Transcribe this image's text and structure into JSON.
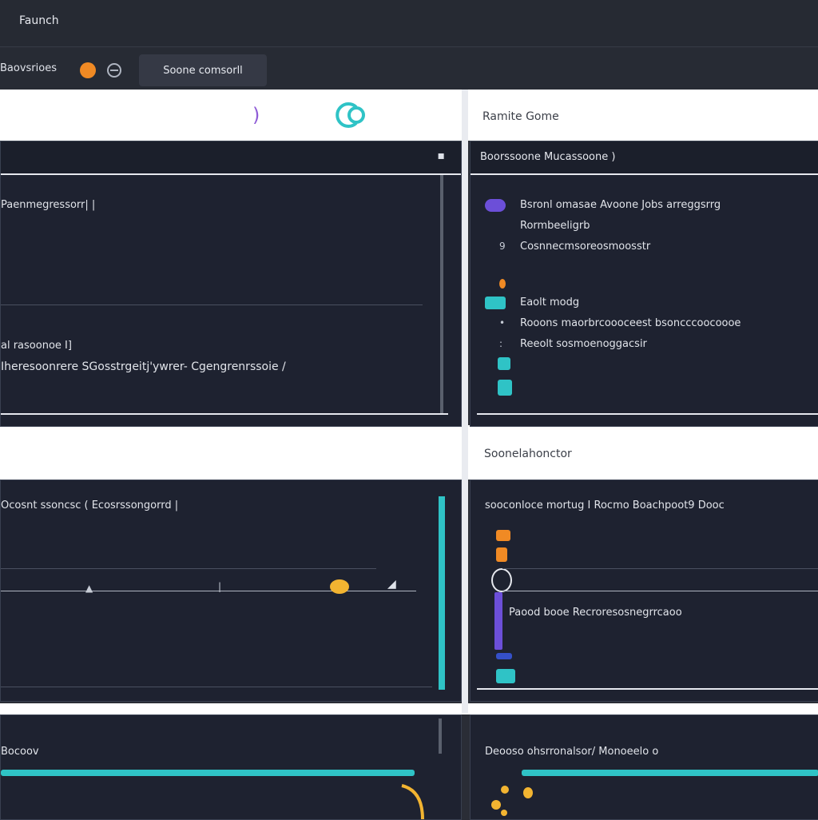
{
  "window": {
    "title": "Faunch"
  },
  "toolbar": {
    "nav_label": "Baovsrioes",
    "button_label": "Soone comsorll"
  },
  "bands": {
    "top_right_label": "Ramite Gome",
    "mid_right_label": "Soonelahonctor"
  },
  "panels": {
    "top_left": {
      "head": "",
      "row1": "Paenmegressorr| |",
      "row2": "al rasoonoe I]",
      "row3": "Iheresoonrere SGosstrgeitj'ywrer- Cgengrenrssoie /"
    },
    "top_right": {
      "head": "Boorssoone Mucassoone )",
      "items": [
        "Bsronl omasae Avoone Jobs arreggsrrg",
        "Rormbeeligrb",
        "Cosnnecmsoreosmoosstr",
        "Eaolt modg",
        "Rooons maorbrcoooceest bsoncccoocoooe",
        "Reeolt sosmoenoggacsir"
      ]
    },
    "mid_left": {
      "head": "Ocosnt ssoncsc ( Ecosrssongorrd |"
    },
    "mid_right": {
      "head": "sooconloce mortug I Rocmo Boachpoot9 Dooc",
      "row": "Paood booe Recroresosnegrrcaoo"
    },
    "bottom_left": {
      "head": "Bocoov"
    },
    "bottom_right": {
      "head": "Deooso ohsrronalsor/ Monoeelo o"
    }
  },
  "colors": {
    "accent_teal": "#2fc3c6",
    "accent_orange": "#f08a24",
    "accent_purple": "#6c4fd8",
    "panel_bg": "#1e2230"
  },
  "icons": [
    "link-icon",
    "logo-c-icon",
    "accent-mark-icon"
  ]
}
